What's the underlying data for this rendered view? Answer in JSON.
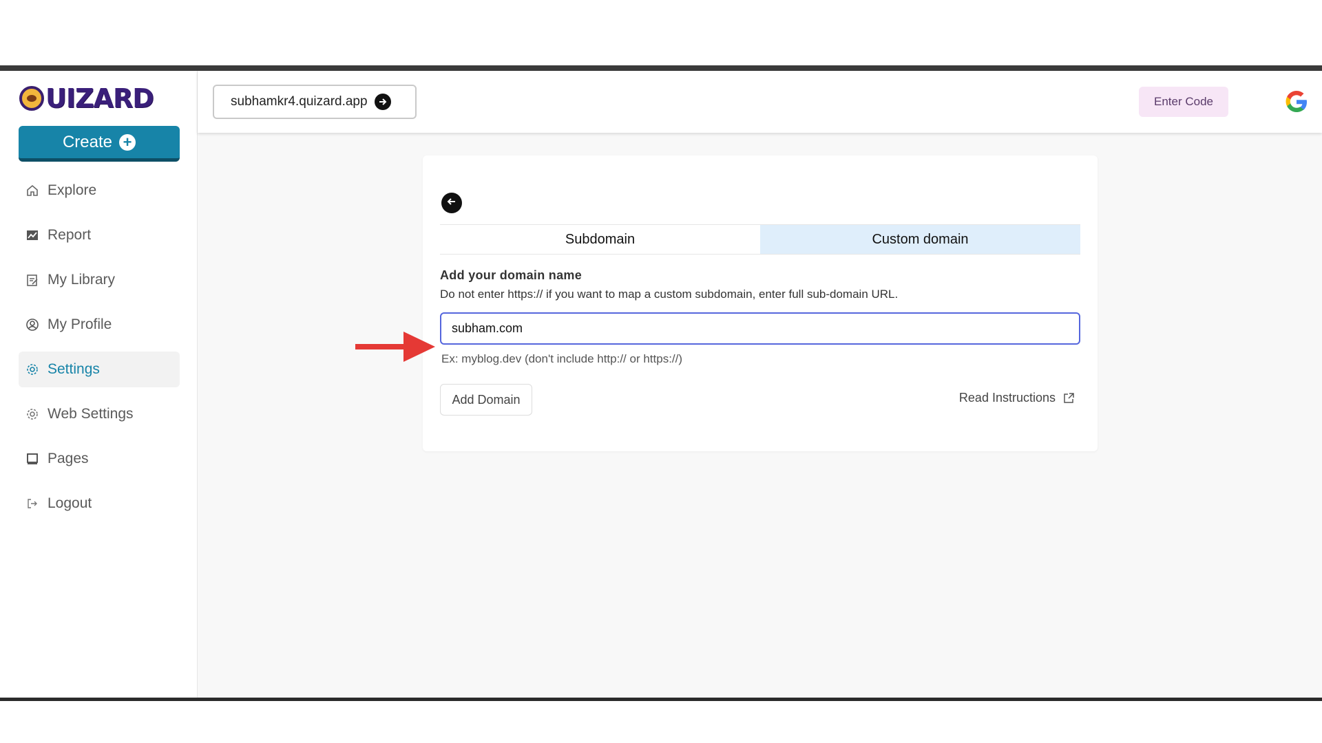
{
  "brand": {
    "logo_text": "UIZARD"
  },
  "sidebar": {
    "create_label": "Create",
    "items": [
      {
        "label": "Explore",
        "icon": "home-icon"
      },
      {
        "label": "Report",
        "icon": "chart-icon"
      },
      {
        "label": "My Library",
        "icon": "library-icon"
      },
      {
        "label": "My Profile",
        "icon": "user-icon"
      },
      {
        "label": "Settings",
        "icon": "gear-icon",
        "active": true
      },
      {
        "label": "Web Settings",
        "icon": "gear-icon"
      },
      {
        "label": "Pages",
        "icon": "pages-icon"
      },
      {
        "label": "Logout",
        "icon": "logout-icon"
      }
    ]
  },
  "header": {
    "site_url": "subhamkr4.quizard.app",
    "enter_code_label": "Enter Code"
  },
  "domain_settings": {
    "tabs": [
      {
        "label": "Subdomain",
        "active": false
      },
      {
        "label": "Custom domain",
        "active": true
      }
    ],
    "form_title": "Add your domain name",
    "description": "Do not enter https:// if you want to map a custom subdomain, enter full sub-domain URL.",
    "input_value": "subham.com",
    "hint": "Ex: myblog.dev (don't include http:// or https://)",
    "add_domain_label": "Add Domain",
    "read_instructions_label": "Read Instructions"
  },
  "colors": {
    "accent": "#1784a8",
    "active_tab_bg": "#dfeefb",
    "input_border": "#5566dd",
    "annotation_arrow": "#e53935"
  }
}
